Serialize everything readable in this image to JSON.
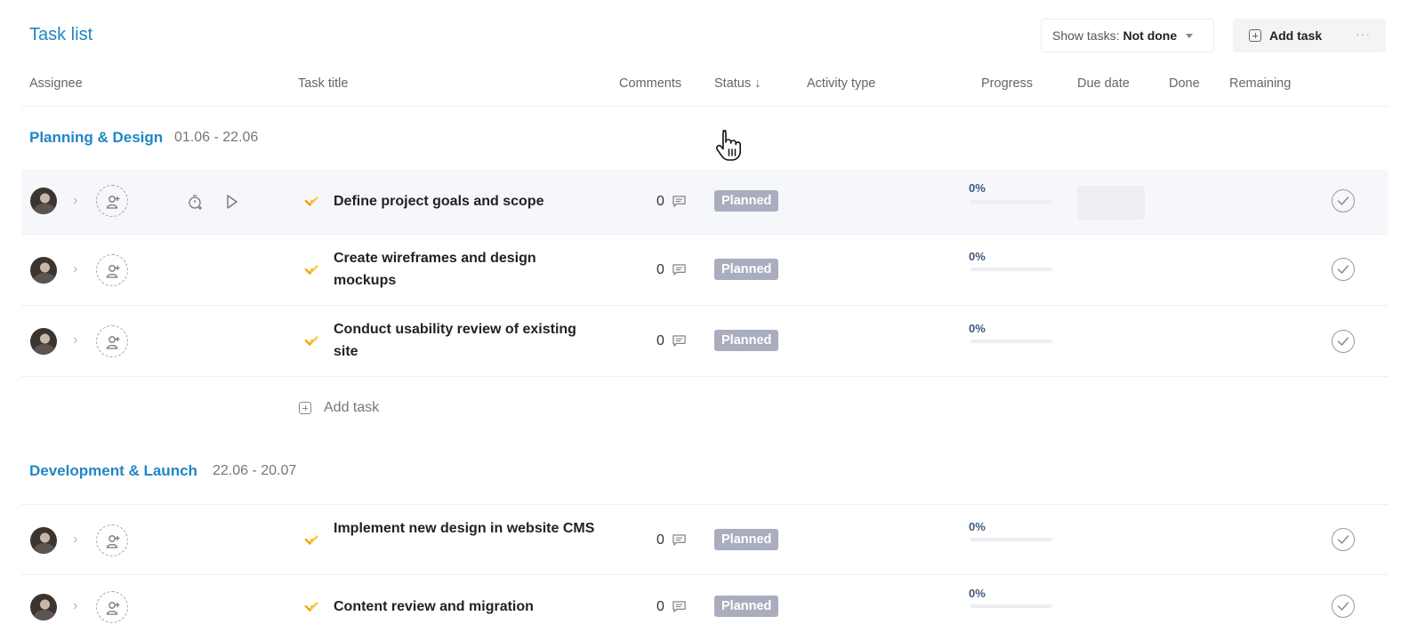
{
  "header": {
    "title": "Task list",
    "filter_label": "Show tasks:",
    "filter_value": "Not done",
    "add_task_label": "Add task",
    "more_label": "···"
  },
  "columns": {
    "assignee": "Assignee",
    "task_title": "Task title",
    "comments": "Comments",
    "status": "Status ↓",
    "activity_type": "Activity type",
    "progress": "Progress",
    "due_date": "Due date",
    "done": "Done",
    "remaining": "Remaining"
  },
  "groups": [
    {
      "title": "Planning & Design",
      "dates": "01.06 - 22.06",
      "add_task_label": "Add task",
      "tasks": [
        {
          "title": "Define project goals and scope",
          "comments": "0",
          "status": "Planned",
          "progress": "0%",
          "progress_fraction": 0
        },
        {
          "title": "Create wireframes and design mockups",
          "comments": "0",
          "status": "Planned",
          "progress": "0%",
          "progress_fraction": 0
        },
        {
          "title": "Conduct usability review of existing site",
          "comments": "0",
          "status": "Planned",
          "progress": "0%",
          "progress_fraction": 0
        }
      ]
    },
    {
      "title": "Development & Launch",
      "dates": "22.06 - 20.07",
      "tasks": [
        {
          "title": "Implement new design in website CMS",
          "comments": "0",
          "status": "Planned",
          "progress": "0%",
          "progress_fraction": 0
        },
        {
          "title": "Content review and migration",
          "comments": "0",
          "status": "Planned",
          "progress": "0%",
          "progress_fraction": 0
        }
      ]
    }
  ],
  "colors": {
    "accent": "#1f86c6",
    "status_planned": "#a9adbe",
    "activity_icon": "#f2a300"
  }
}
